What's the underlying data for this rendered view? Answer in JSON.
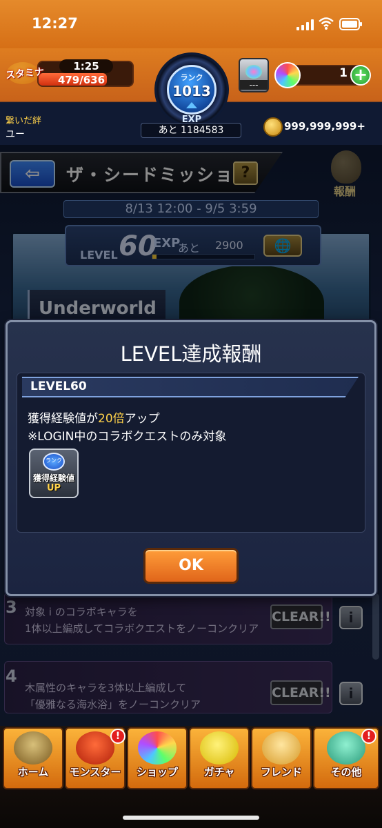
{
  "status_bar": {
    "time": "12:27"
  },
  "hud": {
    "stamina_label": "スタミナ",
    "stamina_timer": "1:25",
    "stamina_count": "479/636",
    "stamina_fraction": 0.753,
    "rank_label": "ランク",
    "rank_value": "1013",
    "exp_label": "EXP",
    "exp_remaining": "あと 1184583",
    "goods_text": "---",
    "orb_count": "1",
    "orb_add": "+",
    "bond_label": "繋いだ絆",
    "bond_name": "ユー",
    "coins": "999,999,999+"
  },
  "mission": {
    "back": "⇦",
    "title": "ザ・シードミッション",
    "help": "?",
    "reward_label": "報酬",
    "period": "8/13 12:00 - 9/5 3:59",
    "level_label": "LEVEL",
    "level_value": "60",
    "exp_label": "EXP",
    "remain_label": "あと",
    "remain_value": "2900",
    "level_progress": 0.04,
    "world_button": "🌐",
    "banner_label": "Underworld"
  },
  "modal": {
    "title": "LEVEL達成報酬",
    "level": "LEVEL60",
    "desc_prefix": "獲得経験値が",
    "desc_highlight": "20倍",
    "desc_suffix": "アップ",
    "desc_line2": "※LOGIN中のコラボクエストのみ対象",
    "item_badge": "ランク",
    "item_label": "獲得経験値",
    "item_up": "UP",
    "ok": "OK"
  },
  "mission_list": [
    {
      "number": "3",
      "line1": "対象 i のコラボキャラを",
      "line2": "1体以上編成してコラボクエストをノーコンクリア",
      "status": "CLEAR!!",
      "info": "i"
    },
    {
      "number": "4",
      "line1": "木属性のキャラを3体以上編成して",
      "line2": "「優雅なる海水浴」をノーコンクリア",
      "status": "CLEAR!!",
      "info": "i"
    }
  ],
  "bottom_nav": [
    {
      "label": "ホーム",
      "icon": "home-gate-icon",
      "alert": ""
    },
    {
      "label": "モンスター",
      "icon": "dragon-icon",
      "alert": "!"
    },
    {
      "label": "ショップ",
      "icon": "orb-icon",
      "alert": ""
    },
    {
      "label": "ガチャ",
      "icon": "egg-icon",
      "alert": ""
    },
    {
      "label": "フレンド",
      "icon": "friends-icon",
      "alert": ""
    },
    {
      "label": "その他",
      "icon": "map-pin-icon",
      "alert": "!"
    }
  ],
  "colors": {
    "accent_orange": "#e0651a",
    "highlight_yellow": "#ffd24a",
    "modal_bg": "#1b2440"
  }
}
